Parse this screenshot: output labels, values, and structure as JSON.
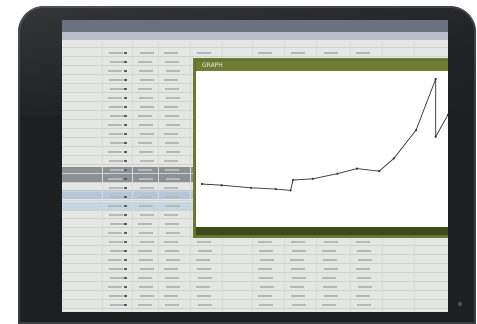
{
  "window": {
    "title": "",
    "menu": [
      "",
      "",
      "",
      "",
      "",
      ""
    ]
  },
  "graph_window": {
    "title": "GRAPH",
    "close_icon": "close-icon"
  },
  "chart_data": {
    "type": "line",
    "title": "",
    "xlabel": "",
    "ylabel": "",
    "x_ticks": [
      "",
      "",
      "",
      ""
    ],
    "series": [
      {
        "values": [
          0.18,
          0.17,
          0.15,
          0.14,
          0.13,
          0.21,
          0.22,
          0.26,
          0.3,
          0.28,
          0.38,
          0.6,
          1.0,
          0.55,
          0.72
        ]
      }
    ],
    "color": "#333333",
    "grid": false,
    "legend": "none"
  },
  "colors": {
    "bezel": "#1d1f21",
    "graph_header": "#6e7d33",
    "sheet_background": "#e4e7e3",
    "selected_row": "#b7c7d9"
  }
}
